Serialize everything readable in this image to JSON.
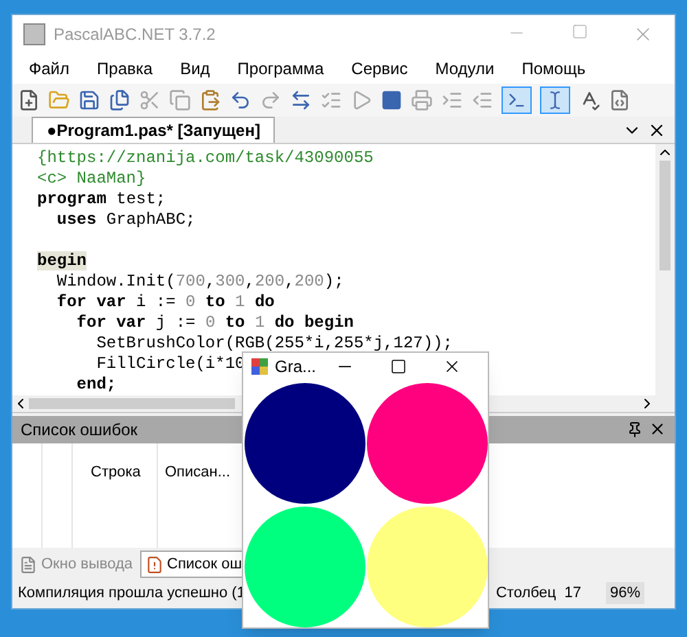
{
  "window": {
    "title": "PascalABC.NET 3.7.2"
  },
  "menu": [
    "Файл",
    "Правка",
    "Вид",
    "Программа",
    "Сервис",
    "Модули",
    "Помощь"
  ],
  "toolbar_toggles": [
    {
      "pressed": true
    },
    {
      "pressed": true
    }
  ],
  "editor": {
    "tab": {
      "label": "●Program1.pas* [Запущен]",
      "selected": true
    },
    "lines": [
      {
        "segments": [
          {
            "kind": "comment",
            "text": "{https://znanija.com/task/43090055"
          }
        ]
      },
      {
        "segments": [
          {
            "kind": "comment",
            "text": "<c> NaaMan}"
          }
        ]
      },
      {
        "segments": [
          {
            "kind": "keyword",
            "text": "program"
          },
          {
            "kind": "plain",
            "text": " test;"
          }
        ]
      },
      {
        "segments": [
          {
            "kind": "keyword",
            "text": "  uses"
          },
          {
            "kind": "plain",
            "text": " GraphABC;"
          }
        ]
      },
      {
        "gap_before": true,
        "segments": [
          {
            "kind": "matched_keyword",
            "text": "begin"
          }
        ]
      },
      {
        "segments": [
          {
            "kind": "plain",
            "text": "  Window.Init("
          },
          {
            "kind": "number",
            "text": "700"
          },
          {
            "kind": "plain",
            "text": ","
          },
          {
            "kind": "number",
            "text": "300"
          },
          {
            "kind": "plain",
            "text": ","
          },
          {
            "kind": "number",
            "text": "200"
          },
          {
            "kind": "plain",
            "text": ","
          },
          {
            "kind": "number",
            "text": "200"
          },
          {
            "kind": "plain",
            "text": ");"
          }
        ]
      },
      {
        "segments": [
          {
            "kind": "keyword",
            "text": "  for var"
          },
          {
            "kind": "plain",
            "text": " i := "
          },
          {
            "kind": "number",
            "text": "0"
          },
          {
            "kind": "keyword",
            "text": " to "
          },
          {
            "kind": "number",
            "text": "1"
          },
          {
            "kind": "keyword",
            "text": " do"
          }
        ]
      },
      {
        "segments": [
          {
            "kind": "keyword",
            "text": "    for var"
          },
          {
            "kind": "plain",
            "text": " j := "
          },
          {
            "kind": "number",
            "text": "0"
          },
          {
            "kind": "keyword",
            "text": " to "
          },
          {
            "kind": "number",
            "text": "1"
          },
          {
            "kind": "keyword",
            "text": " do begin"
          }
        ]
      },
      {
        "segments": [
          {
            "kind": "plain",
            "text": "      SetBrushColor(RGB(255*i,255*j,127));"
          }
        ]
      },
      {
        "segments": [
          {
            "kind": "plain",
            "text": "      FillCircle(i*10"
          }
        ]
      },
      {
        "segments": [
          {
            "kind": "keyword",
            "text": "    end;"
          }
        ]
      }
    ]
  },
  "errors_panel": {
    "title": "Список ошибок",
    "columns": [
      "Строка",
      "Описан..."
    ]
  },
  "bottom_tabs": [
    {
      "label": "Окно вывода",
      "selected": false
    },
    {
      "label": "Список ош",
      "selected": true
    }
  ],
  "status_bar": {
    "message": "Компиляция прошла успешно (1",
    "column_label": "Столбец",
    "column": "17",
    "zoom": "96%"
  },
  "graph_window": {
    "title": "Gra...",
    "circles": [
      {
        "color": "#00007f"
      },
      {
        "color": "#ff007f"
      },
      {
        "color": "#00ff7f"
      },
      {
        "color": "#ffff7f"
      }
    ]
  }
}
